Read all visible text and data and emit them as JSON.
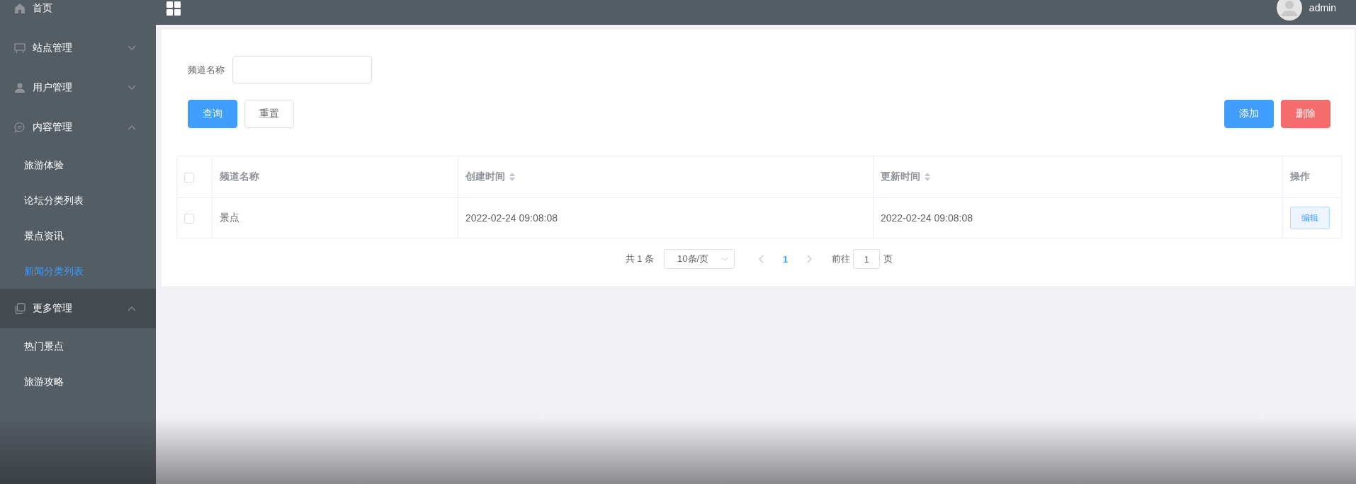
{
  "sidebar": {
    "items": [
      {
        "label": "首页",
        "selected": false,
        "hovered": false
      },
      {
        "label": "站点管理",
        "expanded": false,
        "selected": false,
        "hovered": false
      },
      {
        "label": "用户管理",
        "expanded": false,
        "selected": false,
        "hovered": false
      },
      {
        "label": "内容管理",
        "expanded": true,
        "selected": false,
        "hovered": false,
        "children": [
          {
            "label": "旅游体验",
            "selected": false
          },
          {
            "label": "论坛分类列表",
            "selected": false
          },
          {
            "label": "景点资讯",
            "selected": false
          },
          {
            "label": "新闻分类列表",
            "selected": true
          }
        ]
      },
      {
        "label": "更多管理",
        "expanded": true,
        "selected": false,
        "hovered": true,
        "children": [
          {
            "label": "热门景点",
            "selected": false
          },
          {
            "label": "旅游攻略",
            "selected": false
          }
        ]
      }
    ]
  },
  "header": {
    "user": "admin"
  },
  "search": {
    "label": "频道名称"
  },
  "buttons": [
    {
      "label": "查询",
      "kind": "primary"
    },
    {
      "label": "重置",
      "kind": "default"
    }
  ],
  "actions": [
    {
      "label": "添加",
      "kind": "primary"
    },
    {
      "label": "删除",
      "kind": "danger"
    }
  ],
  "table": {
    "header_checked": false,
    "columns": [
      {
        "label": "频道名称",
        "sortable": false
      },
      {
        "label": "创建时间",
        "sortable": true
      },
      {
        "label": "更新时间",
        "sortable": true
      },
      {
        "label": "操作",
        "sortable": false
      }
    ],
    "rows": [
      {
        "checked": false,
        "cells": [
          "景点",
          "2022-02-24 09:08:08",
          "2022-02-24 09:08:08"
        ],
        "action": "编辑"
      }
    ]
  },
  "pagination": {
    "total": "共 1 条",
    "page_size": "10条/页",
    "pages": [
      {
        "label": "1",
        "selected": true
      }
    ],
    "goto_label": "前往",
    "goto_value": "1",
    "goto_suffix": "页"
  }
}
